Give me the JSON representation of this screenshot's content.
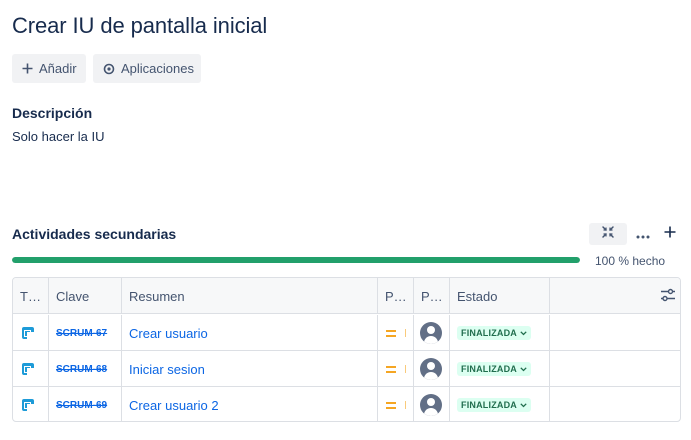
{
  "issue": {
    "title": "Crear IU de pantalla inicial"
  },
  "toolbar": {
    "add_label": "Añadir",
    "apps_label": "Aplicaciones"
  },
  "description": {
    "label": "Descripción",
    "text": "Solo hacer la IU"
  },
  "subtasks": {
    "title": "Actividades secundarias",
    "progress_percent": 100,
    "progress_text": "100 % hecho",
    "columns": [
      "T…",
      "Clave",
      "Resumen",
      "P…",
      "P…",
      "Estado"
    ],
    "rows": [
      {
        "key": "SCRUM-67",
        "summary": "Crear usuario",
        "priority": "medium",
        "status": "FINALIZADA"
      },
      {
        "key": "SCRUM-68",
        "summary": "Iniciar sesion",
        "priority": "medium",
        "status": "FINALIZADA"
      },
      {
        "key": "SCRUM-69",
        "summary": "Crear usuario 2",
        "priority": "medium",
        "status": "FINALIZADA"
      }
    ]
  },
  "icons": {
    "add": "plus-icon",
    "apps": "apps-icon",
    "collapse": "collapse-icon",
    "more": "more-icon",
    "column_settings": "sliders-icon",
    "type": "subtask-icon",
    "priority": "priority-medium-icon",
    "assignee": "avatar-icon",
    "status_dropdown": "chevron-down-icon"
  },
  "colors": {
    "progress": "#22a06b",
    "link": "#0c66e4",
    "status_bg": "#dcfff1",
    "status_text": "#216e4e",
    "priority": "#f5a623"
  }
}
